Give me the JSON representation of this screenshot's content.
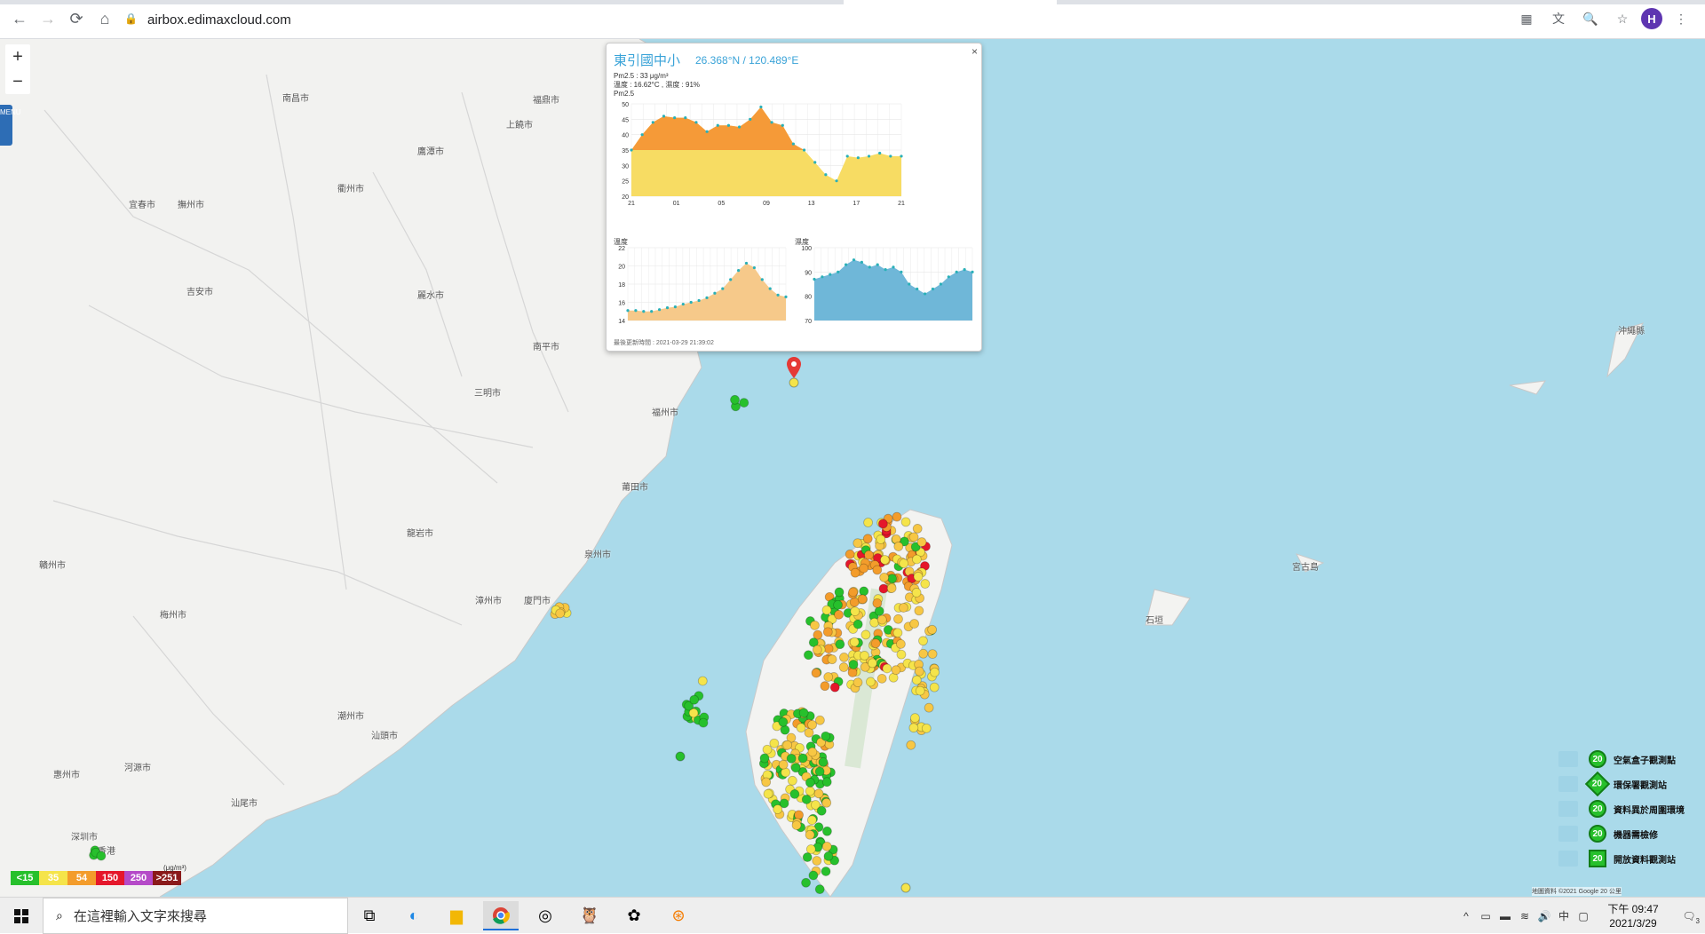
{
  "browser": {
    "url": "airbox.edimaxcloud.com",
    "profile_initial": "H"
  },
  "map": {
    "menu_label": "MENU",
    "places": [
      "南昌市",
      "上饒市",
      "衢州市",
      "麗水市",
      "宜春市",
      "撫州市",
      "鷹潭市",
      "吉安市",
      "南平市",
      "三明市",
      "福州市",
      "莆田市",
      "泉州市",
      "廈門市",
      "龍岩市",
      "梅州市",
      "漳州市",
      "潮州市",
      "汕頭市",
      "贛州市",
      "河源市",
      "惠州市",
      "深圳市",
      "香港",
      "汕尾市",
      "沖繩縣",
      "石垣",
      "宮古島",
      "福鼎市"
    ]
  },
  "popup": {
    "title": "東引國中小",
    "coords": "26.368°N / 120.489°E",
    "pm25_line": "Pm2.5 : 33 μg/m³",
    "temp_hum_line": "溫度 : 16.62°C , 濕度 : 91%",
    "pm25_label": "Pm2.5",
    "temp_label": "溫度",
    "hum_label": "濕度",
    "updated": "最後更新時間 : 2021-03-29 21:39:02",
    "close": "×"
  },
  "chart_data": [
    {
      "type": "area",
      "title": "Pm2.5",
      "x": [
        "21",
        "01",
        "05",
        "09",
        "13",
        "17",
        "21"
      ],
      "ylim": [
        20,
        50
      ],
      "yticks": [
        20,
        25,
        30,
        35,
        40,
        45,
        50
      ],
      "values": [
        35,
        40,
        44,
        46,
        45.5,
        45.5,
        44,
        41,
        43,
        43,
        42.5,
        45,
        49,
        44,
        43,
        37,
        35,
        31,
        27,
        25,
        33,
        32.5,
        33,
        34,
        33,
        33
      ]
    },
    {
      "type": "area",
      "title": "溫度",
      "ylim": [
        14,
        22
      ],
      "yticks": [
        14,
        16,
        18,
        20,
        22
      ],
      "values": [
        15.1,
        15.1,
        15.0,
        15.0,
        15.2,
        15.4,
        15.5,
        15.8,
        16.0,
        16.2,
        16.5,
        17.0,
        17.5,
        18.5,
        19.5,
        20.3,
        19.8,
        18.5,
        17.5,
        16.8,
        16.6
      ]
    },
    {
      "type": "area",
      "title": "濕度",
      "ylim": [
        70,
        100
      ],
      "yticks": [
        70,
        80,
        90,
        100
      ],
      "values": [
        87,
        88,
        89,
        90,
        93,
        95,
        94,
        92,
        93,
        91,
        92,
        90,
        85,
        83,
        81,
        83,
        85,
        88,
        90,
        91,
        90
      ]
    }
  ],
  "legend": {
    "items": [
      "空氣盒子觀測點",
      "環保署觀測站",
      "資料異於周圍環境",
      "機器需檢修",
      "開放資料觀測站"
    ],
    "badge_value": "20",
    "scale": [
      {
        "label": "<15",
        "color": "#27c02c"
      },
      {
        "label": "35",
        "color": "#f5e44a"
      },
      {
        "label": "54",
        "color": "#f39c2b"
      },
      {
        "label": "150",
        "color": "#e5172b"
      },
      {
        "label": "250",
        "color": "#b54ac8"
      },
      {
        "label": ">251",
        "color": "#8a1a1a"
      }
    ],
    "unit": "(μg/m³)"
  },
  "map_footer": "地圖資料 ©2021 Google   20 公里",
  "taskbar": {
    "search_placeholder": "在這裡輸入文字來搜尋",
    "ime": "中",
    "time": "下午 09:47",
    "date": "2021/3/29",
    "notif_count": "3"
  }
}
